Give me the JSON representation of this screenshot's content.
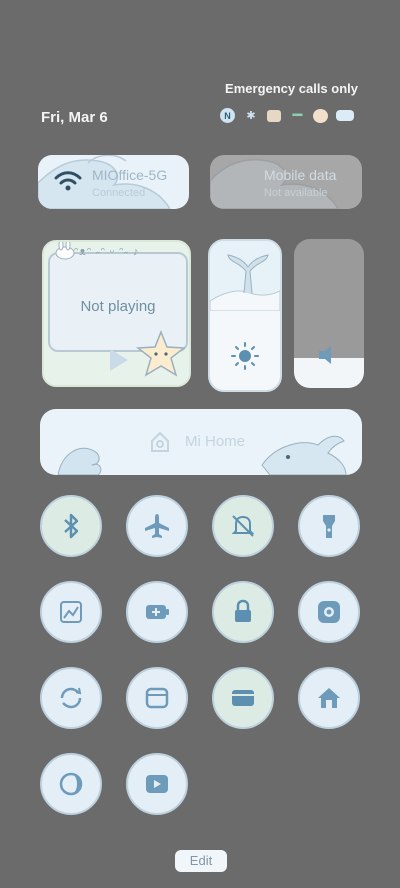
{
  "status": {
    "carrier_text": "Emergency calls only",
    "date": "Fri, Mar 6"
  },
  "tiles": {
    "wifi": {
      "title": "MIOffice-5G",
      "subtitle": "Connected"
    },
    "mobile": {
      "title": "Mobile data",
      "subtitle": "Not available"
    }
  },
  "media": {
    "status": "Not playing",
    "decor_text": "ᵔᴥᵔ ˶ᵔ ᵕ ᵔ˶ ♪"
  },
  "sliders": {
    "brightness_level": 0.5,
    "volume_level": 0.2
  },
  "mihome": {
    "label": "Mi Home"
  },
  "toggles": [
    {
      "icon": "bluetooth-icon",
      "state": "on"
    },
    {
      "icon": "airplane-icon",
      "state": "off"
    },
    {
      "icon": "mute-icon",
      "state": "on"
    },
    {
      "icon": "flashlight-icon",
      "state": "off"
    },
    {
      "icon": "screenshot-icon",
      "state": "off"
    },
    {
      "icon": "battery-saver-icon",
      "state": "off"
    },
    {
      "icon": "lock-screen-icon",
      "state": "on"
    },
    {
      "icon": "scanner-icon",
      "state": "off"
    },
    {
      "icon": "auto-rotate-icon",
      "state": "off"
    },
    {
      "icon": "floating-window-icon",
      "state": "off"
    },
    {
      "icon": "cast-icon",
      "state": "on"
    },
    {
      "icon": "home-icon",
      "state": "off"
    },
    {
      "icon": "eye-comfort-icon",
      "state": "off"
    },
    {
      "icon": "video-toolbox-icon",
      "state": "off"
    }
  ],
  "footer": {
    "edit_label": "Edit"
  },
  "colors": {
    "background": "#6b6b6b",
    "tile_light": "#e8f2f8",
    "tile_disabled": "#a7a7a7",
    "accent_blue": "#5d8fb0"
  }
}
